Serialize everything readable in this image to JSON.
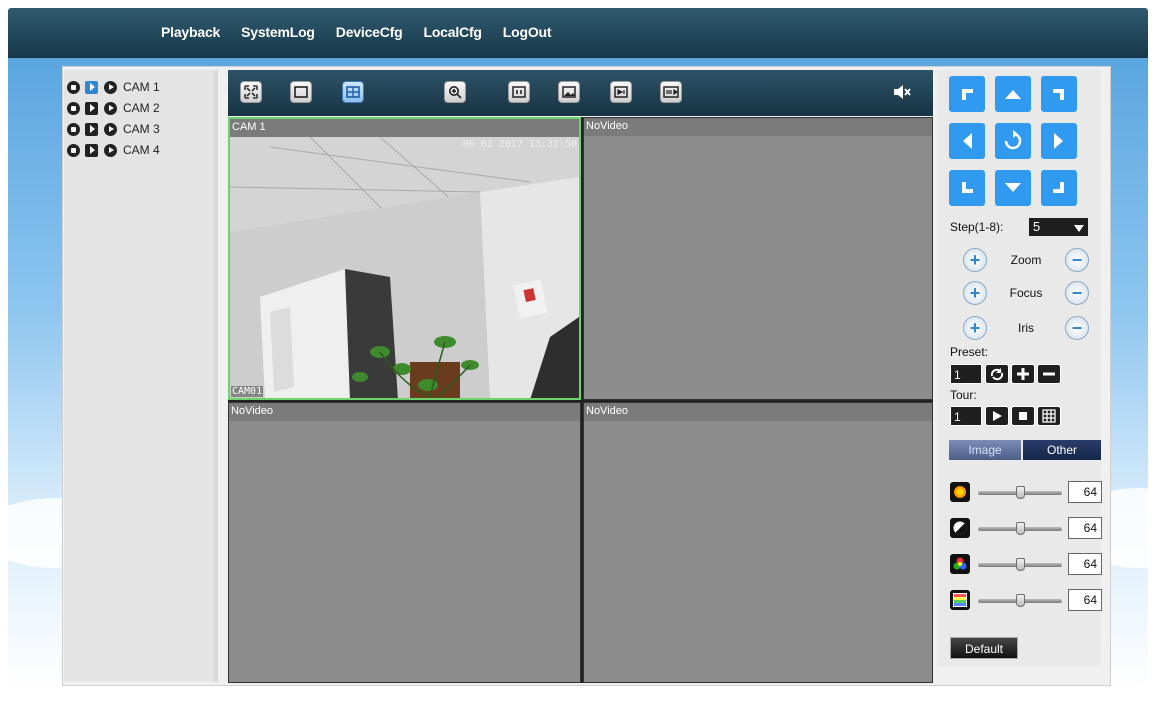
{
  "nav": {
    "items": [
      "Playback",
      "SystemLog",
      "DeviceCfg",
      "LocalCfg",
      "LogOut"
    ]
  },
  "cameras": [
    {
      "label": "CAM 1",
      "playing": true
    },
    {
      "label": "CAM 2",
      "playing": false
    },
    {
      "label": "CAM 3",
      "playing": false
    },
    {
      "label": "CAM 4",
      "playing": false
    }
  ],
  "toolbar": {
    "buttons": [
      "fullscreen-icon",
      "single-view-icon",
      "quad-view-icon",
      "zoom-in-icon",
      "stop-all-icon",
      "snapshot-icon",
      "record-icon",
      "record-all-icon"
    ],
    "active_layout": "quad",
    "mute_icon": "mute-icon"
  },
  "video": {
    "cells": [
      {
        "header": "CAM 1",
        "timestamp": "06 02 2017 13:32:50",
        "osd_tag": "CAM01",
        "selected": true
      },
      {
        "header": "NoVideo"
      },
      {
        "header": "NoVideo"
      },
      {
        "header": "NoVideo"
      }
    ]
  },
  "ptz": {
    "step_label": "Step(1-8):",
    "step_value": "5",
    "zoom_label": "Zoom",
    "focus_label": "Focus",
    "iris_label": "Iris",
    "preset_label": "Preset:",
    "preset_value": "1",
    "tour_label": "Tour:",
    "tour_value": "1",
    "accent": "#2f9af0"
  },
  "image_panel": {
    "tab_image": "Image",
    "tab_other": "Other",
    "brightness": "64",
    "contrast": "64",
    "saturation": "64",
    "hue": "64",
    "default_label": "Default"
  }
}
